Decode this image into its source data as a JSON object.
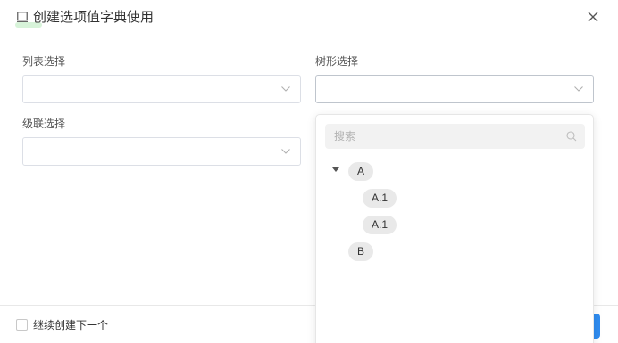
{
  "dialog": {
    "title": "创建选项值字典使用",
    "accent_color": "#2f8cf0"
  },
  "form": {
    "list_select": {
      "label": "列表选择",
      "value": ""
    },
    "tree_select": {
      "label": "树形选择",
      "value": ""
    },
    "cascader_select": {
      "label": "级联选择",
      "value": ""
    }
  },
  "tree_dropdown": {
    "search_placeholder": "搜索",
    "nodes": [
      {
        "label": "A",
        "expanded": true
      },
      {
        "label": "A.1"
      },
      {
        "label": "A.1"
      },
      {
        "label": "B"
      }
    ]
  },
  "footer": {
    "continue_label": "继续创建下一个",
    "continue_checked": false
  }
}
